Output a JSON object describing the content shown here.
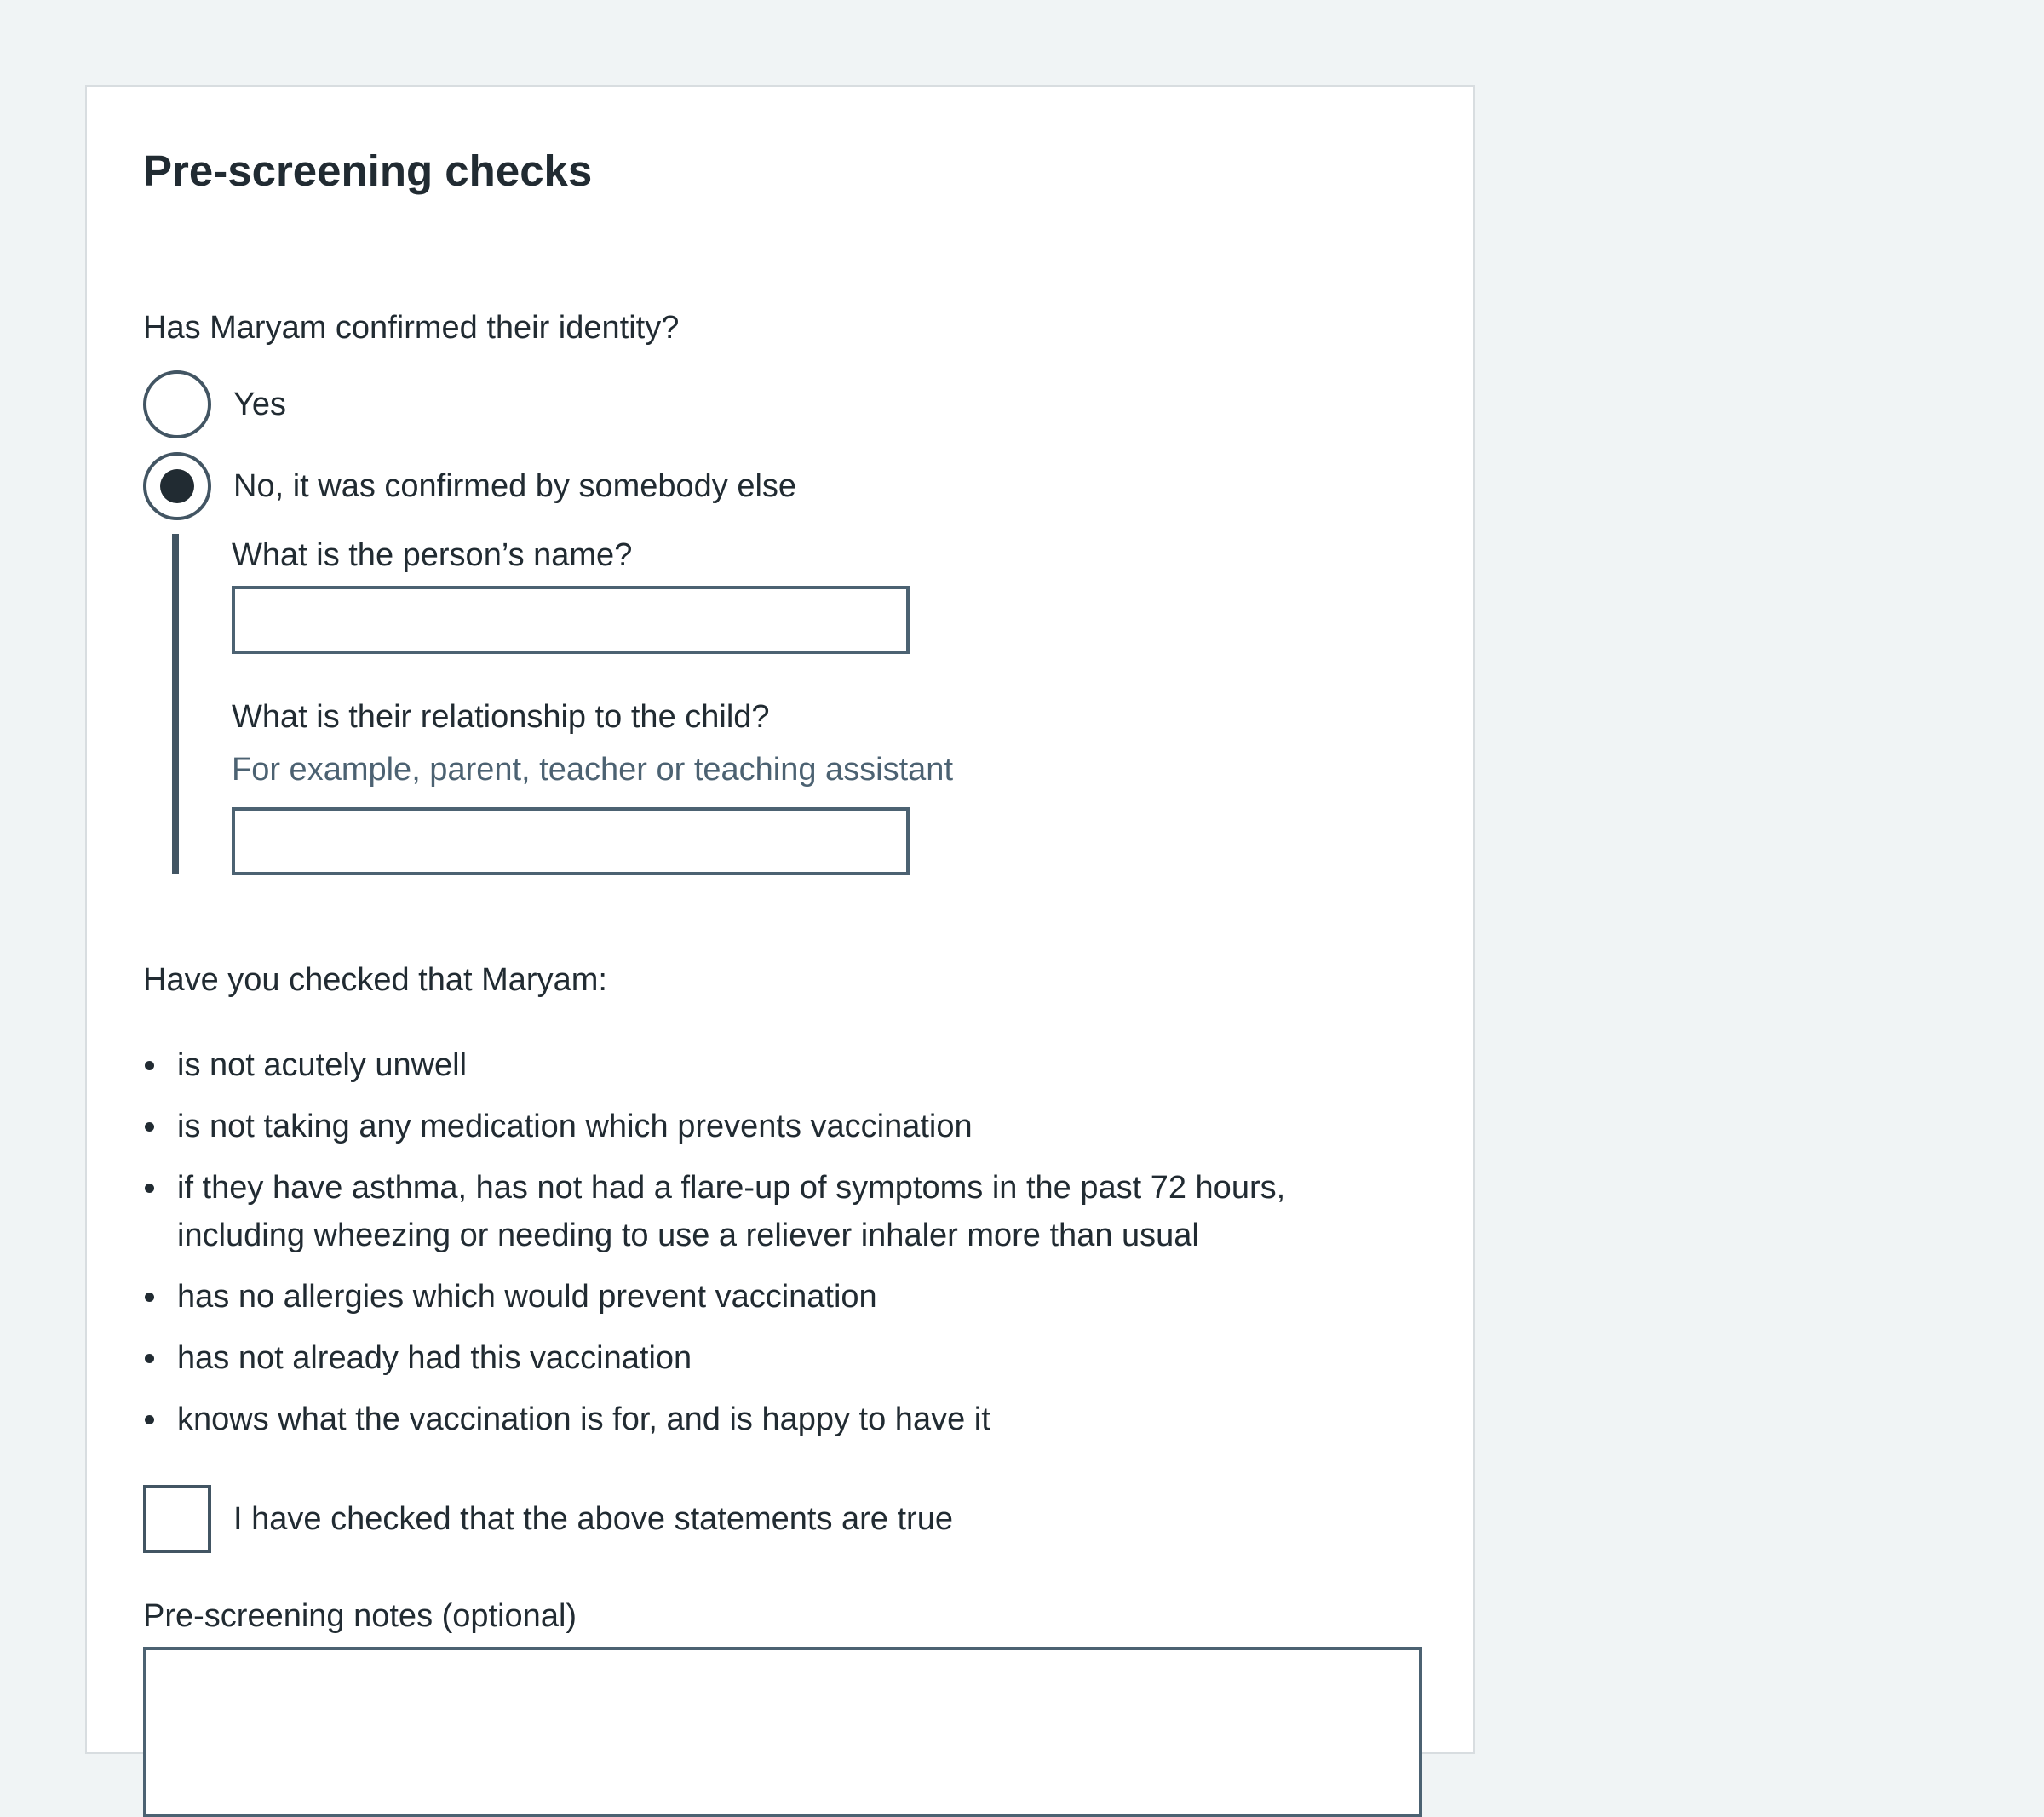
{
  "form": {
    "title": "Pre-screening checks",
    "identity_question": "Has Maryam confirmed their identity?",
    "identity_options": [
      {
        "label": "Yes",
        "selected": false
      },
      {
        "label": "No, it was confirmed by somebody else",
        "selected": true
      }
    ],
    "person_name_label": "What is the person’s name?",
    "person_name_value": "",
    "relationship_label": "What is their relationship to the child?",
    "relationship_hint": "For example, parent, teacher or teaching assistant",
    "relationship_value": "",
    "checks_intro": "Have you checked that Maryam:",
    "checks": [
      "is not acutely unwell",
      "is not taking any medication which prevents vaccination",
      "if they have asthma, has not had a flare-up of symptoms in the past 72 hours, including wheezing or needing to use a reliever inhaler more than usual",
      "has no allergies which would prevent vaccination",
      "has not already had this vaccination",
      "knows what the vaccination is for, and is happy to have it"
    ],
    "confirm_checkbox_label": "I have checked that the above statements are true",
    "confirm_checked": false,
    "notes_label": "Pre-screening notes (optional)",
    "notes_value": ""
  },
  "colors": {
    "background": "#f0f4f5",
    "text": "#212b32",
    "border": "#425563",
    "hint": "#4c6272"
  }
}
